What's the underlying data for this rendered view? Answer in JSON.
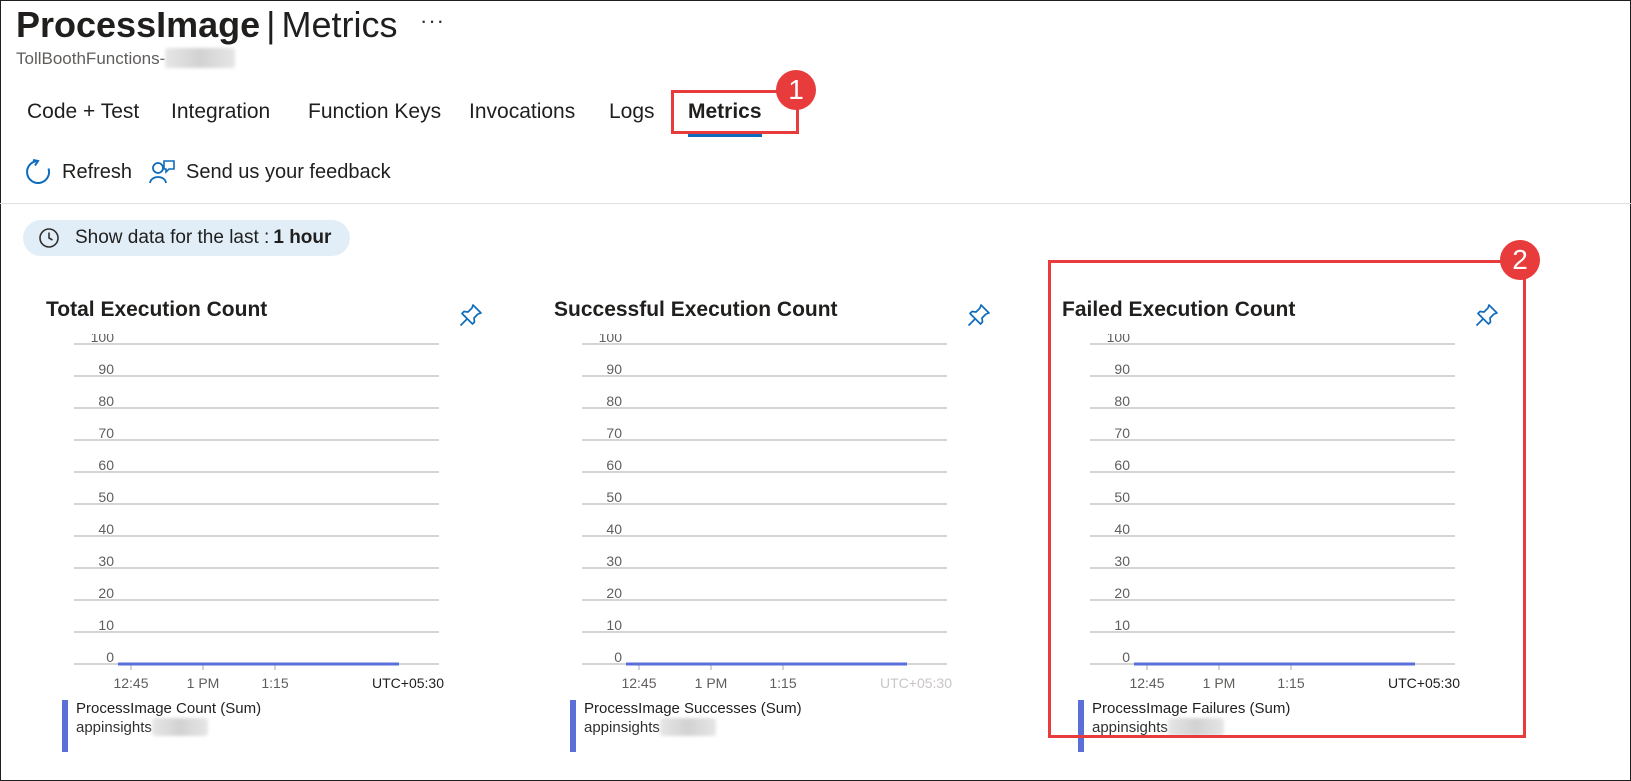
{
  "header": {
    "title_bold": "ProcessImage",
    "title_sep": "|",
    "title_rest": "Metrics",
    "more": "···",
    "subtitle": "TollBoothFunctions-"
  },
  "tabs": [
    {
      "label": "Code + Test"
    },
    {
      "label": "Integration"
    },
    {
      "label": "Function Keys"
    },
    {
      "label": "Invocations"
    },
    {
      "label": "Logs"
    },
    {
      "label": "Metrics",
      "active": true
    }
  ],
  "toolbar": {
    "refresh_label": "Refresh",
    "feedback_label": "Send us your feedback"
  },
  "time_filter": {
    "label": "Show data for the last :",
    "value": "1 hour"
  },
  "callouts": [
    "1",
    "2"
  ],
  "colors": {
    "accent": "#0f6cbd",
    "series": "#5b6fd9",
    "callout": "#e83b3b"
  },
  "chart_data": [
    {
      "type": "line",
      "title": "Total Execution Count",
      "x_ticks": [
        "12:45",
        "1 PM",
        "1:15"
      ],
      "timezone": "UTC+05:30",
      "y_ticks": [
        100,
        90,
        80,
        70,
        60,
        50,
        40,
        30,
        20,
        10,
        0
      ],
      "ylim": [
        0,
        100
      ],
      "series": [
        {
          "name": "ProcessImage Count (Sum)",
          "values": [
            0,
            0
          ]
        }
      ],
      "source": "appinsights"
    },
    {
      "type": "line",
      "title": "Successful Execution Count",
      "x_ticks": [
        "12:45",
        "1 PM",
        "1:15"
      ],
      "timezone": "UTC+05:30",
      "y_ticks": [
        100,
        90,
        80,
        70,
        60,
        50,
        40,
        30,
        20,
        10,
        0
      ],
      "ylim": [
        0,
        100
      ],
      "series": [
        {
          "name": "ProcessImage Successes (Sum)",
          "values": [
            0,
            0
          ]
        }
      ],
      "source": "appinsights"
    },
    {
      "type": "line",
      "title": "Failed Execution Count",
      "x_ticks": [
        "12:45",
        "1 PM",
        "1:15"
      ],
      "timezone": "UTC+05:30",
      "y_ticks": [
        100,
        90,
        80,
        70,
        60,
        50,
        40,
        30,
        20,
        10,
        0
      ],
      "ylim": [
        0,
        100
      ],
      "series": [
        {
          "name": "ProcessImage Failures (Sum)",
          "values": [
            0,
            0
          ]
        }
      ],
      "source": "appinsights"
    }
  ]
}
